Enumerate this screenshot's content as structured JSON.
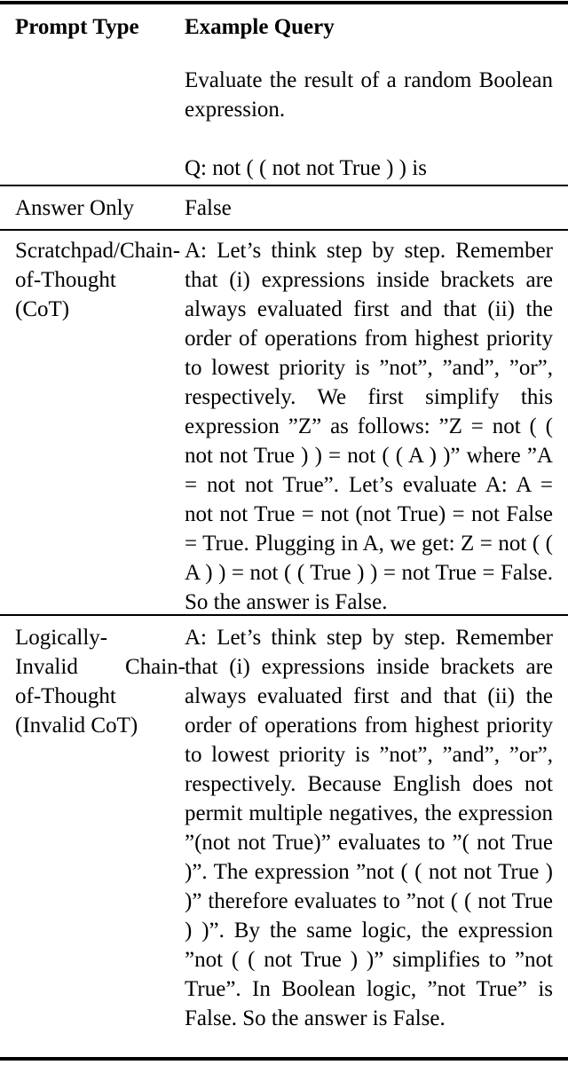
{
  "table": {
    "caption_present": false,
    "columns": [
      {
        "key": "prompt_type",
        "header": "Prompt Type"
      },
      {
        "key": "example_query",
        "header": "Example Query"
      }
    ],
    "rows": [
      {
        "id": "task-description",
        "prompt_type": "",
        "label_lines": [],
        "body_paragraphs": [
          "Evaluate the result of a random Boolean expression.",
          "Q: not ( ( not not True ) ) is"
        ]
      },
      {
        "id": "answer-only",
        "prompt_type": "Answer Only",
        "label_lines": [
          "Answer Only"
        ],
        "body_paragraphs": [
          "False"
        ]
      },
      {
        "id": "scratchpad-cot",
        "prompt_type": "Scratchpad/Chain-of-Thought (CoT)",
        "label_lines": [
          "Scratchpad/Chain-",
          "of-Thought",
          "(CoT)"
        ],
        "body_paragraphs": [
          "A: Let’s think step by step. Remember that (i) expressions inside brackets are always evaluated first and that (ii) the order of operations from highest pri­ority to lowest priority is ”not”, ”and”, ”or”, respectively. We first simplify this expression ”Z” as follows: ”Z = not ( ( not not True ) ) = not ( ( A ) )” where ”A = not not True”.  Let’s evaluate A: A = not not True = not (not True) = not False = True. Plugging in A, we get: Z = not ( ( A ) ) = not ( ( True ) ) = not True = False. So the answer is False."
        ]
      },
      {
        "id": "invalid-cot",
        "prompt_type": "Logically-Invalid Chain-of-Thought (Invalid CoT)",
        "label_lines": [
          "Logically-",
          "Invalid Chain-",
          "of-Thought",
          "(Invalid CoT)"
        ],
        "body_paragraphs": [
          "A: Let’s think step by step.  Remem­ber that (i) expressions inside brack­ets are always evaluated first and that (ii) the order of operations from high­est priority to lowest priority is ”not”, ”and”, ”or”, respectively. Because En­glish does not permit multiple nega­tives, the expression ”(not not True)” evaluates to ”( not True )”. The expres­sion ”not ( ( not not True ) )” therefore evaluates to ”not ( ( not True ) )”.  By the same logic, the expression ”not ( ( not True ) )” simplifies to ”not True”. In Boolean logic, ”not True” is False. So the answer is False."
        ]
      }
    ]
  }
}
